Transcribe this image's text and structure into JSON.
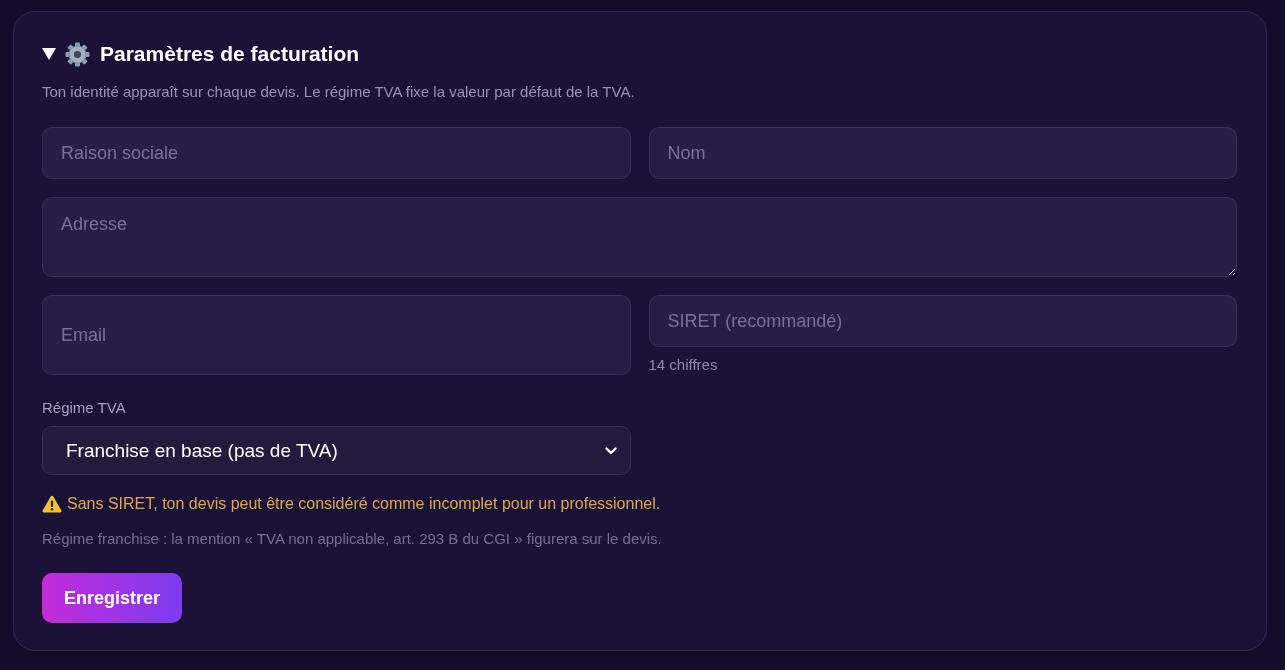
{
  "panel": {
    "expanded": true,
    "title": "Paramètres de facturation",
    "description": "Ton identité apparaît sur chaque devis. Le régime TVA fixe la valeur par défaut de la TVA.",
    "fields": [
      {
        "kind": "input",
        "placeholder": "Raison sociale"
      },
      {
        "kind": "input",
        "placeholder": "Nom"
      },
      {
        "kind": "textarea",
        "placeholder": "Adresse"
      },
      {
        "kind": "input",
        "placeholder": "Email"
      },
      {
        "kind": "input",
        "placeholder": "SIRET (recommandé)",
        "hint": "14 chiffres"
      }
    ],
    "vat_regime": {
      "label": "Régime TVA",
      "value": "Franchise en base (pas de TVA)"
    },
    "messages": [
      {
        "kind": "warning",
        "text": "Sans SIRET, ton devis peut être considéré comme incomplet pour un professionnel."
      },
      {
        "kind": "note",
        "text": "Régime franchise : la mention « TVA non applicable, art. 293 B du CGI » figurera sur le devis."
      }
    ],
    "save_button": "Enregistrer"
  }
}
